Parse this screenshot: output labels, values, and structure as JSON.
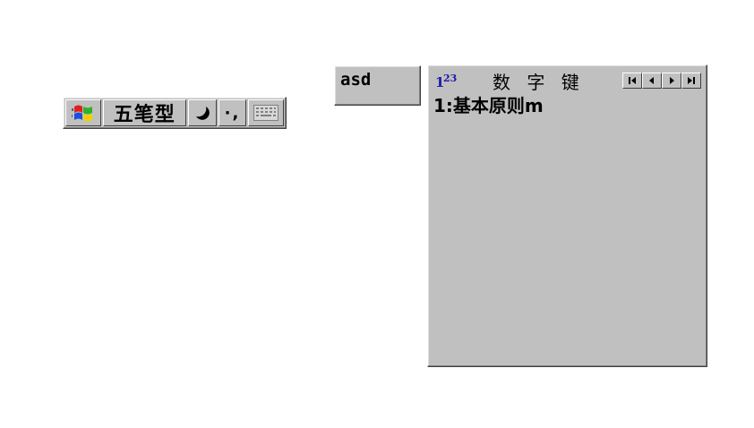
{
  "ime_toolbar": {
    "logo_icon": "windows-flag-icon",
    "input_mode": "五笔型",
    "width_icon": "half-moon-icon",
    "punctuation": "·,",
    "keyboard_icon": "soft-keyboard-icon"
  },
  "composition": {
    "text": "asd"
  },
  "candidate_window": {
    "mode_icon": "numeric-123-icon",
    "title": "数 字 键",
    "nav_icons": [
      "first-page-icon",
      "prev-page-icon",
      "next-page-icon",
      "last-page-icon"
    ],
    "candidates": [
      {
        "label": "1:基本原则m"
      }
    ]
  }
}
